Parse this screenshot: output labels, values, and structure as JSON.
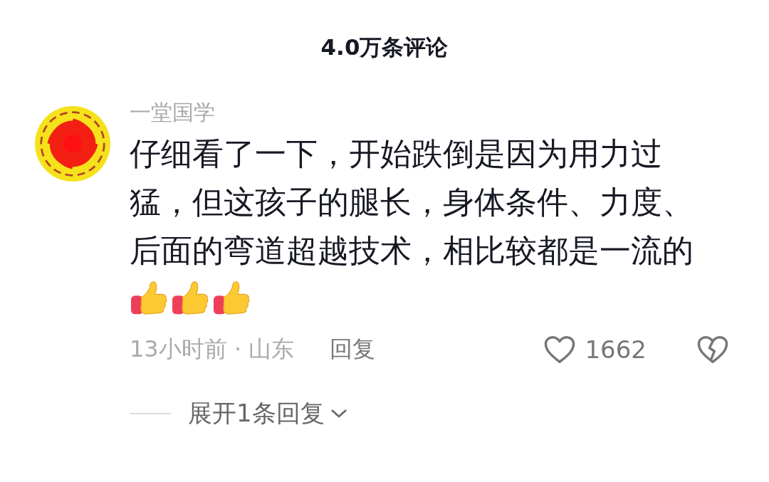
{
  "header": {
    "title": "4.0万条评论"
  },
  "comment": {
    "username": "一堂国学",
    "text": "仔细看了一下，开始跌倒是因为用力过猛，但这孩子的腿长，身体条件、力度、后面的弯道超越技术，相比较都是一流的",
    "emojis": [
      {
        "kind": "thumbs-up"
      },
      {
        "kind": "thumbs-up"
      },
      {
        "kind": "thumbs-up"
      }
    ],
    "meta": "13小时前 · 山东",
    "reply_button": "回复",
    "liked": false,
    "likes": "1662",
    "expand_replies": "展开1条回复"
  }
}
